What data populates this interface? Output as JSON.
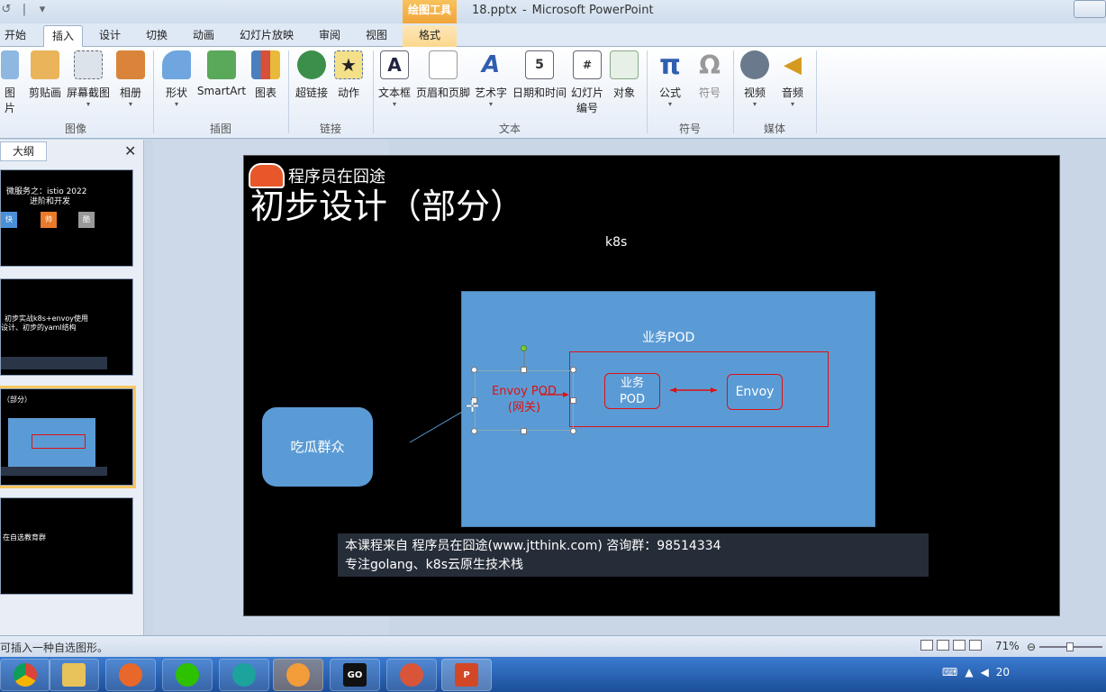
{
  "window": {
    "title": "18.pptx",
    "app": "Microsoft PowerPoint",
    "context_tool": "绘图工具"
  },
  "tabs": [
    "开始",
    "插入",
    "设计",
    "切换",
    "动画",
    "幻灯片放映",
    "审阅",
    "视图",
    "格式"
  ],
  "ribbon": {
    "buttons": {
      "picture": "图片",
      "clipart": "剪贴画",
      "screenshot": "屏幕截图",
      "album": "相册",
      "shapes": "形状",
      "smartart": "SmartArt",
      "chart": "图表",
      "hyperlink": "超链接",
      "action": "动作",
      "textbox": "文本框",
      "header_footer": "页眉和页脚",
      "wordart": "艺术字",
      "datetime": "日期和时间",
      "slide_number_1": "幻灯片",
      "slide_number_2": "编号",
      "object": "对象",
      "equation": "公式",
      "symbol": "符号",
      "video": "视频",
      "audio": "音频"
    },
    "groups": {
      "images": "图像",
      "illustrations": "插图",
      "links": "链接",
      "text": "文本",
      "symbols": "符号",
      "media": "媒体"
    }
  },
  "left_panel": {
    "tab": "大纲",
    "thumbs": [
      {
        "line1": "微服务之：istio 2022",
        "line2": "进阶和开发",
        "b1": "快",
        "b2": "帅",
        "b3": "酷"
      },
      {
        "line1": "初步实战k8s+envoy使用",
        "line2": "设计、初步的yaml结构"
      },
      {
        "line1": "（部分）"
      },
      {
        "line1": "在自选教育群"
      }
    ]
  },
  "slide": {
    "logo": "程序员在囧途",
    "title": "初步设计（部分）",
    "k8s": "k8s",
    "bizpod": "业务POD",
    "inner_biz_1": "业务",
    "inner_biz_2": "POD",
    "inner_envoy": "Envoy",
    "gateway_1": "Envoy POD",
    "gateway_2": "(网关)",
    "crowd": "吃瓜群众",
    "watermark_1": "本课程来自 程序员在囧途(www.jtthink.com) 咨询群：98514334",
    "watermark_2": "专注golang、k8s云原生技术栈"
  },
  "status": {
    "text": "可插入一种自选图形。",
    "zoom": "71%"
  },
  "taskbar": {
    "apps": [
      "chrome",
      "explorer",
      "firefox",
      "wechat",
      "app5",
      "app6",
      "goland",
      "app8",
      "powerpoint"
    ],
    "go_label": "GO",
    "clock": "20"
  },
  "colors": {
    "k8s_box": "#5b9bd5",
    "red_outline": "#dd1111",
    "context_tab": "#f1a53a"
  }
}
